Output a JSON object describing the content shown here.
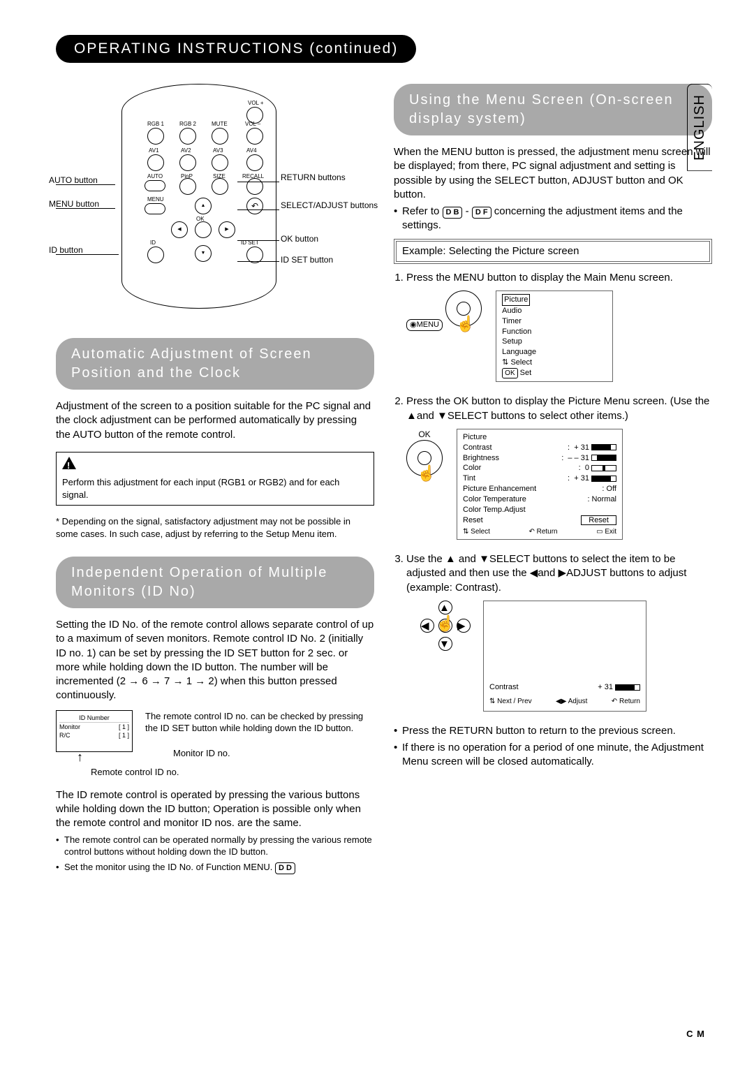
{
  "lang_tab": "ENGLISH",
  "page_title": "OPERATING INSTRUCTIONS (continued)",
  "footer": "C M",
  "remote": {
    "labels": {
      "vol_plus": "VOL +",
      "rgb1": "RGB 1",
      "rgb2": "RGB 2",
      "mute": "MUTE",
      "vol_minus": "VOL –",
      "av1": "AV1",
      "av2": "AV2",
      "av3": "AV3",
      "av4": "AV4",
      "auto": "AUTO",
      "pinp": "PinP",
      "size": "SIZE",
      "recall": "RECALL",
      "menu": "MENU",
      "ok": "OK",
      "id": "ID",
      "idset": "ID SET"
    },
    "callouts": {
      "auto_btn": "AUTO button",
      "menu_btn": "MENU button",
      "id_btn": "ID button",
      "return_btns": "RETURN buttons",
      "select_adjust": "SELECT/ADJUST buttons",
      "ok_btn": "OK button",
      "idset_btn": "ID SET button"
    }
  },
  "auto_adj": {
    "title": "Automatic Adjustment of Screen Position and the Clock",
    "body": "Adjustment of the screen to a position suitable for the PC signal and the clock adjustment can be performed automatically by pressing the AUTO button of the remote control.",
    "warning": "Perform this adjustment for each input (RGB1 or RGB2) and for each signal.",
    "note": "* Depending on the signal, satisfactory adjustment may not be possible in some cases. In such case, adjust by referring to the Setup Menu item."
  },
  "idno": {
    "title": "Independent Operation of Multiple Monitors (ID No)",
    "body1": "Setting the ID No. of the remote control allows separate control of up to a maximum of seven monitors. Remote control ID No. 2 (initially ID no. 1) can be set by pressing the ID SET button for 2 sec. or more while holding down the ID button.  The number will be incremented (2 → 6 → 7 → 1 → 2) when this button pressed continuously.",
    "caption1": "The remote control ID no. can be checked by pressing the ID SET button while holding down the ID button.",
    "monitor_id": "Monitor ID no.",
    "remote_id": "Remote control ID no.",
    "idbox": {
      "title": "ID Number",
      "monitor": "Monitor",
      "rc": "R/C",
      "val": "[ 1 ]"
    },
    "body2": "The ID remote control is operated by pressing the various buttons while holding down the ID button; Operation is possible only when the remote control and monitor ID nos. are the same.",
    "bullet1": "The remote control can be operated normally by pressing the various remote control buttons without holding down the ID button.",
    "bullet2_a": "Set the monitor using the ID No. of Function MENU.",
    "bullet2_ref": "D D"
  },
  "menu": {
    "title": "Using the Menu Screen (On-screen display system)",
    "intro": "When the MENU button is pressed, the adjustment menu screen will be displayed; from there, PC signal adjustment and setting is possible by using the SELECT button, ADJUST button and OK button.",
    "refer_a": "Refer to ",
    "refer_db": "D B",
    "refer_sep": " - ",
    "refer_df": "D F",
    "refer_b": " concerning the adjustment items and the settings.",
    "example": "Example: Selecting the Picture screen",
    "step1": "Press the MENU button to display the Main Menu screen.",
    "main_menu": {
      "items": [
        "Picture",
        "Audio",
        "Timer",
        "Function",
        "Setup",
        "Language"
      ],
      "select": "Select",
      "set": "Set",
      "ok": "OK"
    },
    "step2": "Press the OK button to display the Picture Menu screen. (Use the  ▲and  ▼SELECT buttons to select other items.)",
    "ok_label": "OK",
    "picture_menu": {
      "title": "Picture",
      "rows": [
        {
          "k": "Contrast",
          "v": "+ 31"
        },
        {
          "k": "Brightness",
          "v": "– – 31"
        },
        {
          "k": "Color",
          "v": "0"
        },
        {
          "k": "Tint",
          "v": "+ 31"
        },
        {
          "k": "Picture Enhancement",
          "v": "Off"
        },
        {
          "k": "Color Temperature",
          "v": "Normal"
        },
        {
          "k": "Color Temp.Adjust",
          "v": ""
        },
        {
          "k": "Reset",
          "v": ""
        }
      ],
      "reset": "Reset",
      "footer_select": "Select",
      "footer_return": "Return",
      "footer_exit": "Exit"
    },
    "step3": "Use the  ▲ and  ▼SELECT buttons to select the item to be adjusted and then use the   ◀and   ▶ADJUST buttons to adjust (example: Contrast).",
    "contrast_screen": {
      "label": "Contrast",
      "value": "+ 31",
      "next": "Next / Prev",
      "adjust": "Adjust",
      "return": "Return"
    },
    "end_bullet1": "Press the RETURN button to return to the previous screen.",
    "end_bullet2": "If there is no operation for a period of one minute, the Adjustment Menu screen will be closed automatically."
  }
}
